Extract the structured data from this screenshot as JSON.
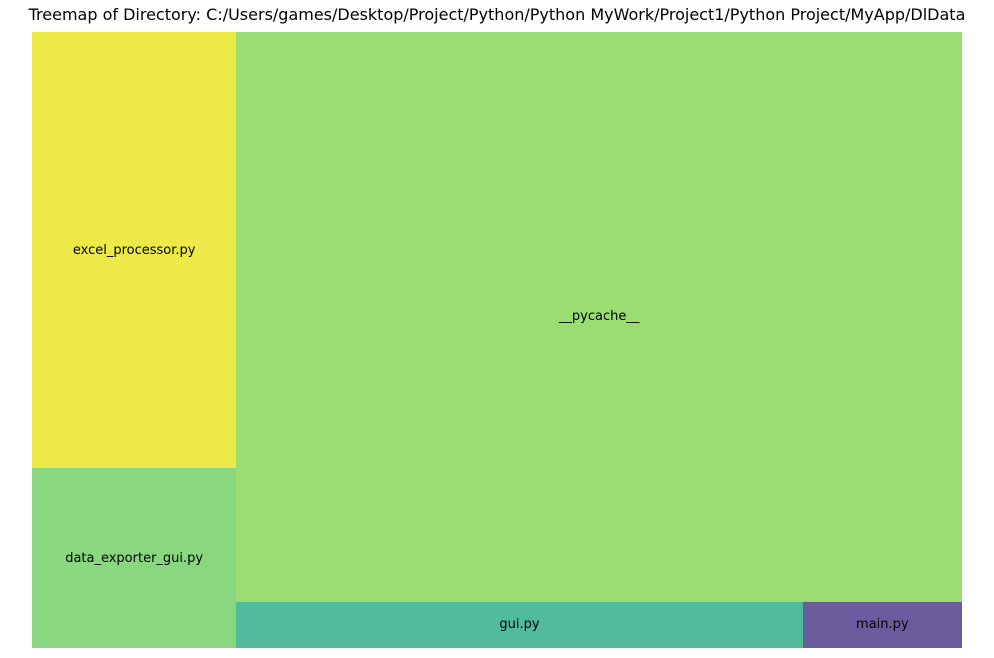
{
  "chart_data": {
    "type": "treemap",
    "title": "Treemap of Directory: C:/Users/games/Desktop/Project/Python/Python MyWork/Project1/Python Project/MyApp/DlData",
    "items": [
      {
        "label": "excel_processor.py",
        "value": 109,
        "color": "#ECE949"
      },
      {
        "label": "data_exporter_gui.py",
        "value": 45,
        "color": "#89D87F"
      },
      {
        "label": "__pycache__",
        "value": 506,
        "color": "#9BDC73"
      },
      {
        "label": "gui.py",
        "value": 32,
        "color": "#51BB9B"
      },
      {
        "label": "main.py",
        "value": 9,
        "color": "#6A5C9D"
      }
    ]
  }
}
